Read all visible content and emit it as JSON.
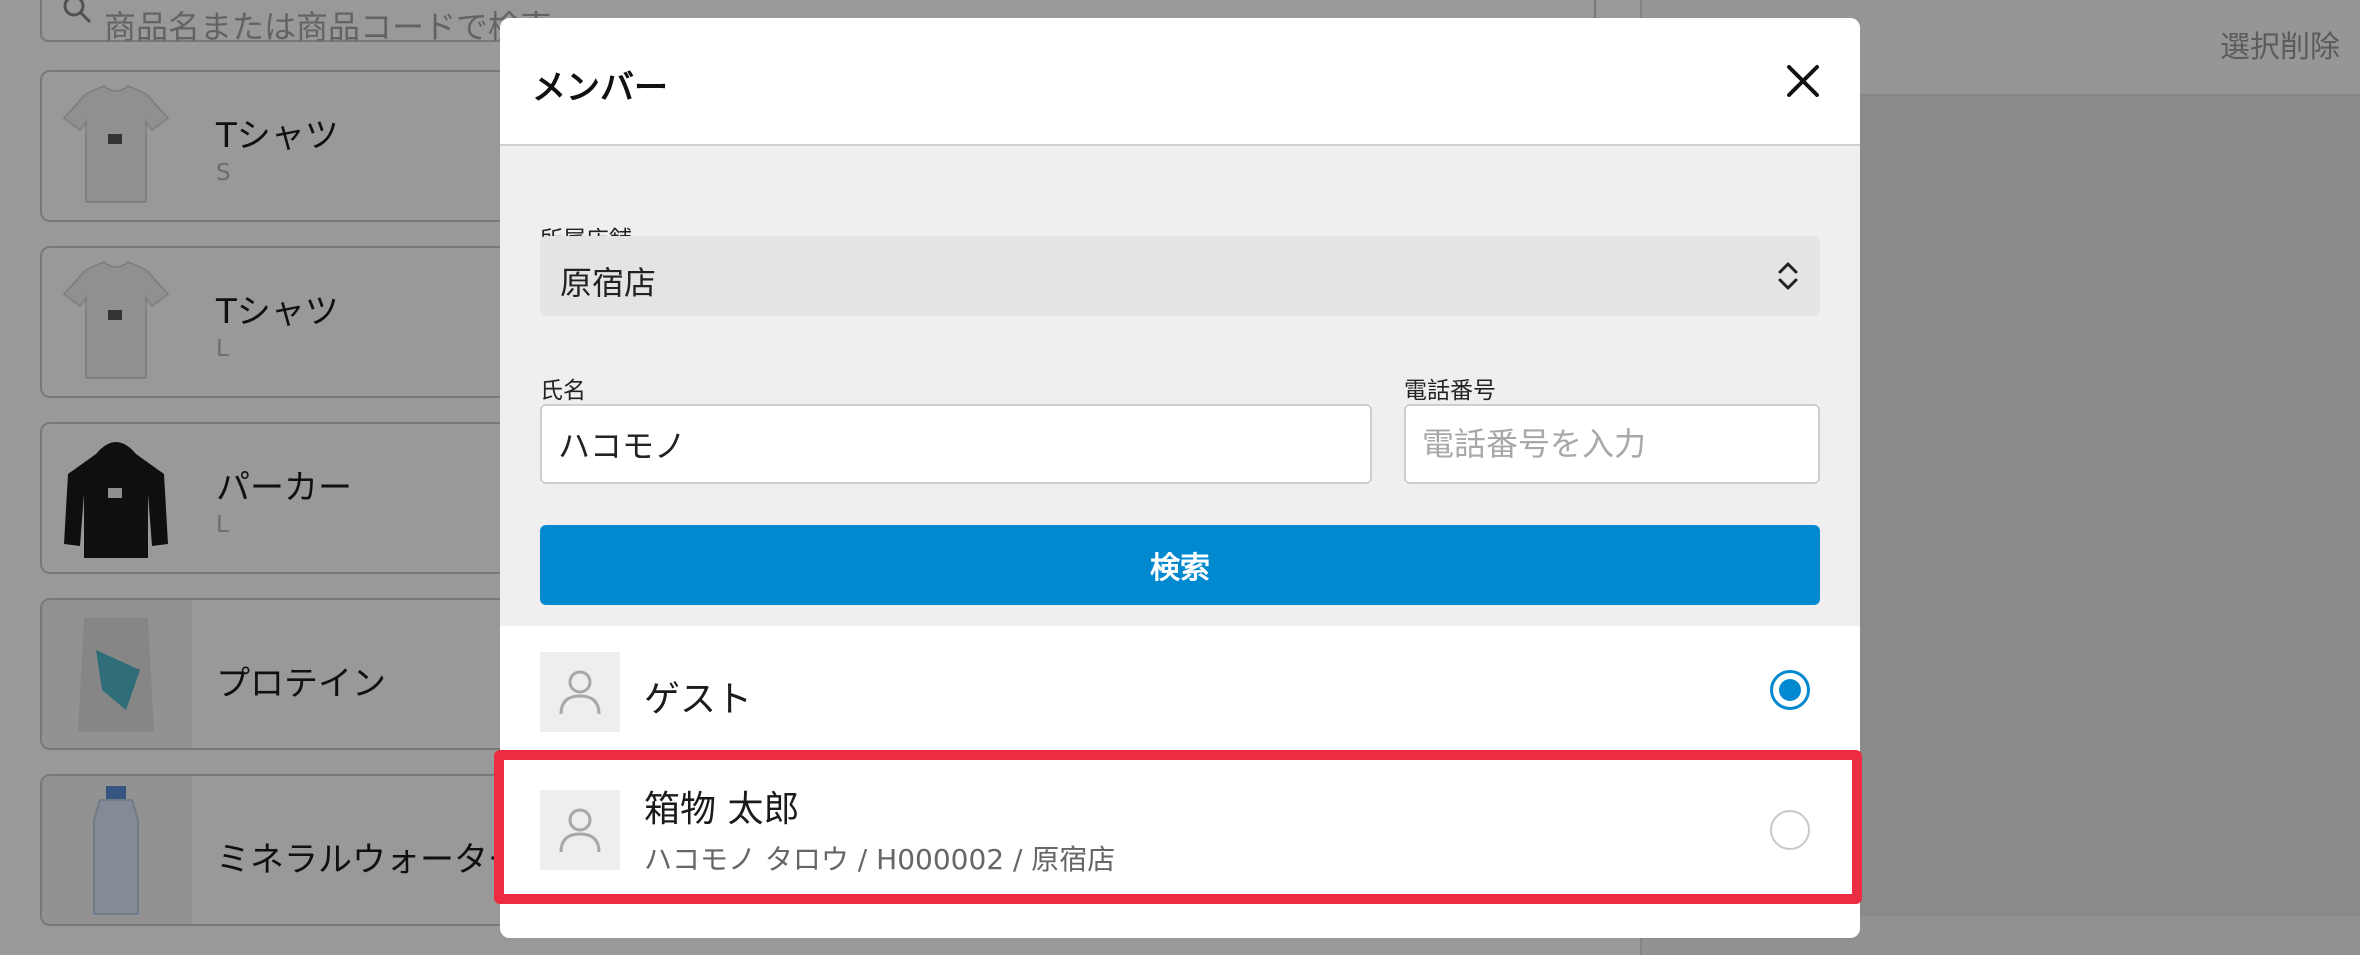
{
  "background": {
    "search_placeholder": "商品名または商品コードで検索",
    "products": [
      {
        "name": "Tシャツ",
        "size": "S",
        "thumb": "tshirt-white"
      },
      {
        "name": "Tシャツ",
        "size": "L",
        "thumb": "tshirt-white"
      },
      {
        "name": "パーカー",
        "size": "L",
        "thumb": "hoodie-black"
      },
      {
        "name": "プロテイン",
        "size": "",
        "thumb": "protein-bag"
      },
      {
        "name": "ミネラルウォーター",
        "size": "",
        "thumb": "water-bottle"
      }
    ],
    "clear_selection_label": "選択削除"
  },
  "modal": {
    "title": "メンバー",
    "store_label": "所属店舗",
    "store_value": "原宿店",
    "name_label": "氏名",
    "name_value": "ハコモノ",
    "phone_label": "電話番号",
    "phone_placeholder": "電話番号を入力",
    "search_button": "検索",
    "members": [
      {
        "name": "ゲスト",
        "detail": "",
        "selected": true
      },
      {
        "name": "箱物 太郎",
        "detail": "ハコモノ タロウ / H000002 / 原宿店",
        "selected": false
      }
    ]
  },
  "colors": {
    "primary": "#0189d0",
    "highlight": "#ec2d41"
  },
  "icons": [
    "search-icon",
    "close-icon",
    "select-arrows-icon",
    "avatar-icon",
    "radio-icon"
  ]
}
